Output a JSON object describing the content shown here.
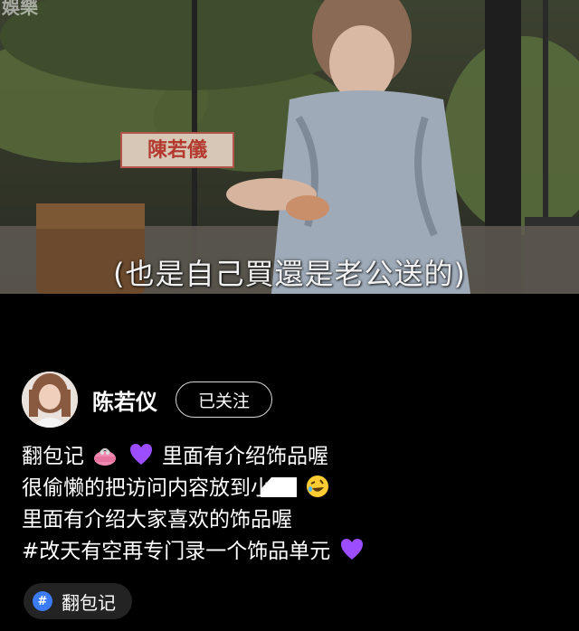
{
  "video": {
    "watermark": "娛樂",
    "name_card": "陳若儀",
    "subtitle": "(也是自己買還是老公送的)"
  },
  "author": {
    "name": "陈若仪",
    "follow_label": "已关注"
  },
  "post": {
    "line1_text": "翻包记",
    "line1_tail": "里面有介绍饰品喔",
    "line2_text": "很偷懒的把访问内容放到小",
    "line3_text": "里面有介绍大家喜欢的饰品喔",
    "line4_text": "#改天有空再专门录一个饰品单元",
    "emojis": [
      "purse-emoji",
      "purple-heart-emoji",
      "rolling-laughing-emoji",
      "purple-heart-emoji"
    ]
  },
  "tag": {
    "icon": "#",
    "label": "翻包记"
  },
  "colors": {
    "background": "#000000",
    "tag_icon": "#3b7bf6",
    "heart": "#9b4dff"
  }
}
